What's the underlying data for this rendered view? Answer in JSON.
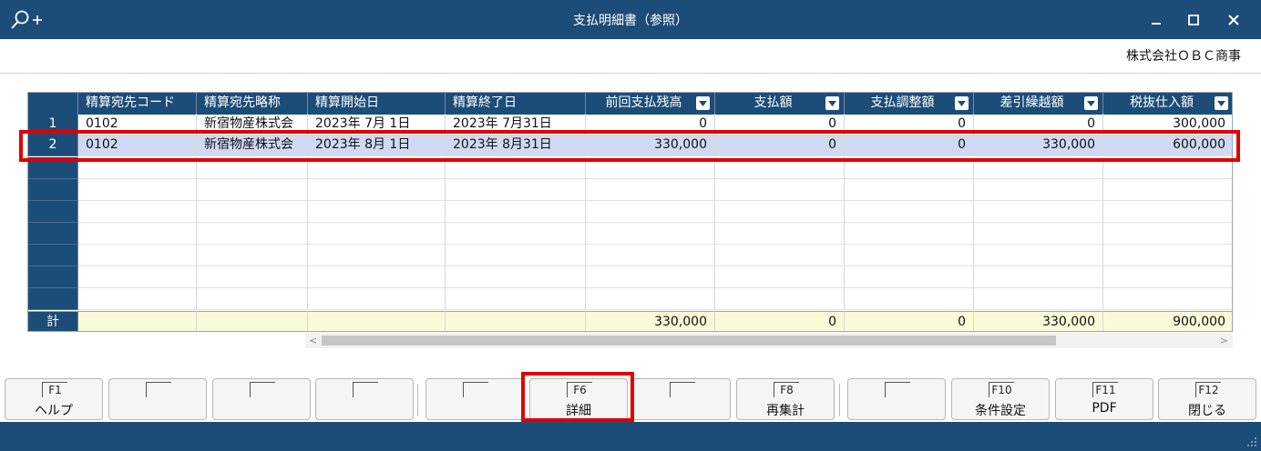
{
  "window": {
    "title": "支払明細書（参照）",
    "company": "株式会社ＯＢＣ商事",
    "minimize_label": "–",
    "maximize_label": "□",
    "close_label": "✕"
  },
  "table": {
    "columns": [
      "精算宛先コード",
      "精算宛先略称",
      "精算開始日",
      "精算終了日",
      "前回支払残高",
      "支払額",
      "支払調整額",
      "差引繰越額",
      "税抜仕入額"
    ],
    "rows": [
      {
        "no": "1",
        "cells": [
          "0102",
          "新宿物産株式会",
          "2023年  7月  1日",
          "2023年  7月31日",
          "0",
          "0",
          "0",
          "0",
          "300,000"
        ]
      },
      {
        "no": "2",
        "cells": [
          "0102",
          "新宿物産株式会",
          "2023年  8月  1日",
          "2023年  8月31日",
          "330,000",
          "0",
          "0",
          "330,000",
          "600,000"
        ]
      }
    ],
    "total": {
      "label": "計",
      "cells": [
        "",
        "",
        "",
        "",
        "330,000",
        "0",
        "0",
        "330,000",
        "900,000"
      ]
    },
    "selected_row": "2"
  },
  "fkeys": [
    {
      "key": "F1",
      "label": "ヘルプ"
    },
    {
      "key": "",
      "label": ""
    },
    {
      "key": "",
      "label": ""
    },
    {
      "key": "",
      "label": ""
    },
    {
      "key": "",
      "label": ""
    },
    {
      "key": "F6",
      "label": "詳細"
    },
    {
      "key": "",
      "label": ""
    },
    {
      "key": "F8",
      "label": "再集計"
    },
    {
      "key": "",
      "label": ""
    },
    {
      "key": "F10",
      "label": "条件設定"
    },
    {
      "key": "F11",
      "label": "PDF"
    },
    {
      "key": "F12",
      "label": "閉じる"
    }
  ],
  "colors": {
    "titlebar": "#1c4d78",
    "selection": "#d0d8f2",
    "total_row": "#fafad8",
    "highlight": "#e00000"
  }
}
